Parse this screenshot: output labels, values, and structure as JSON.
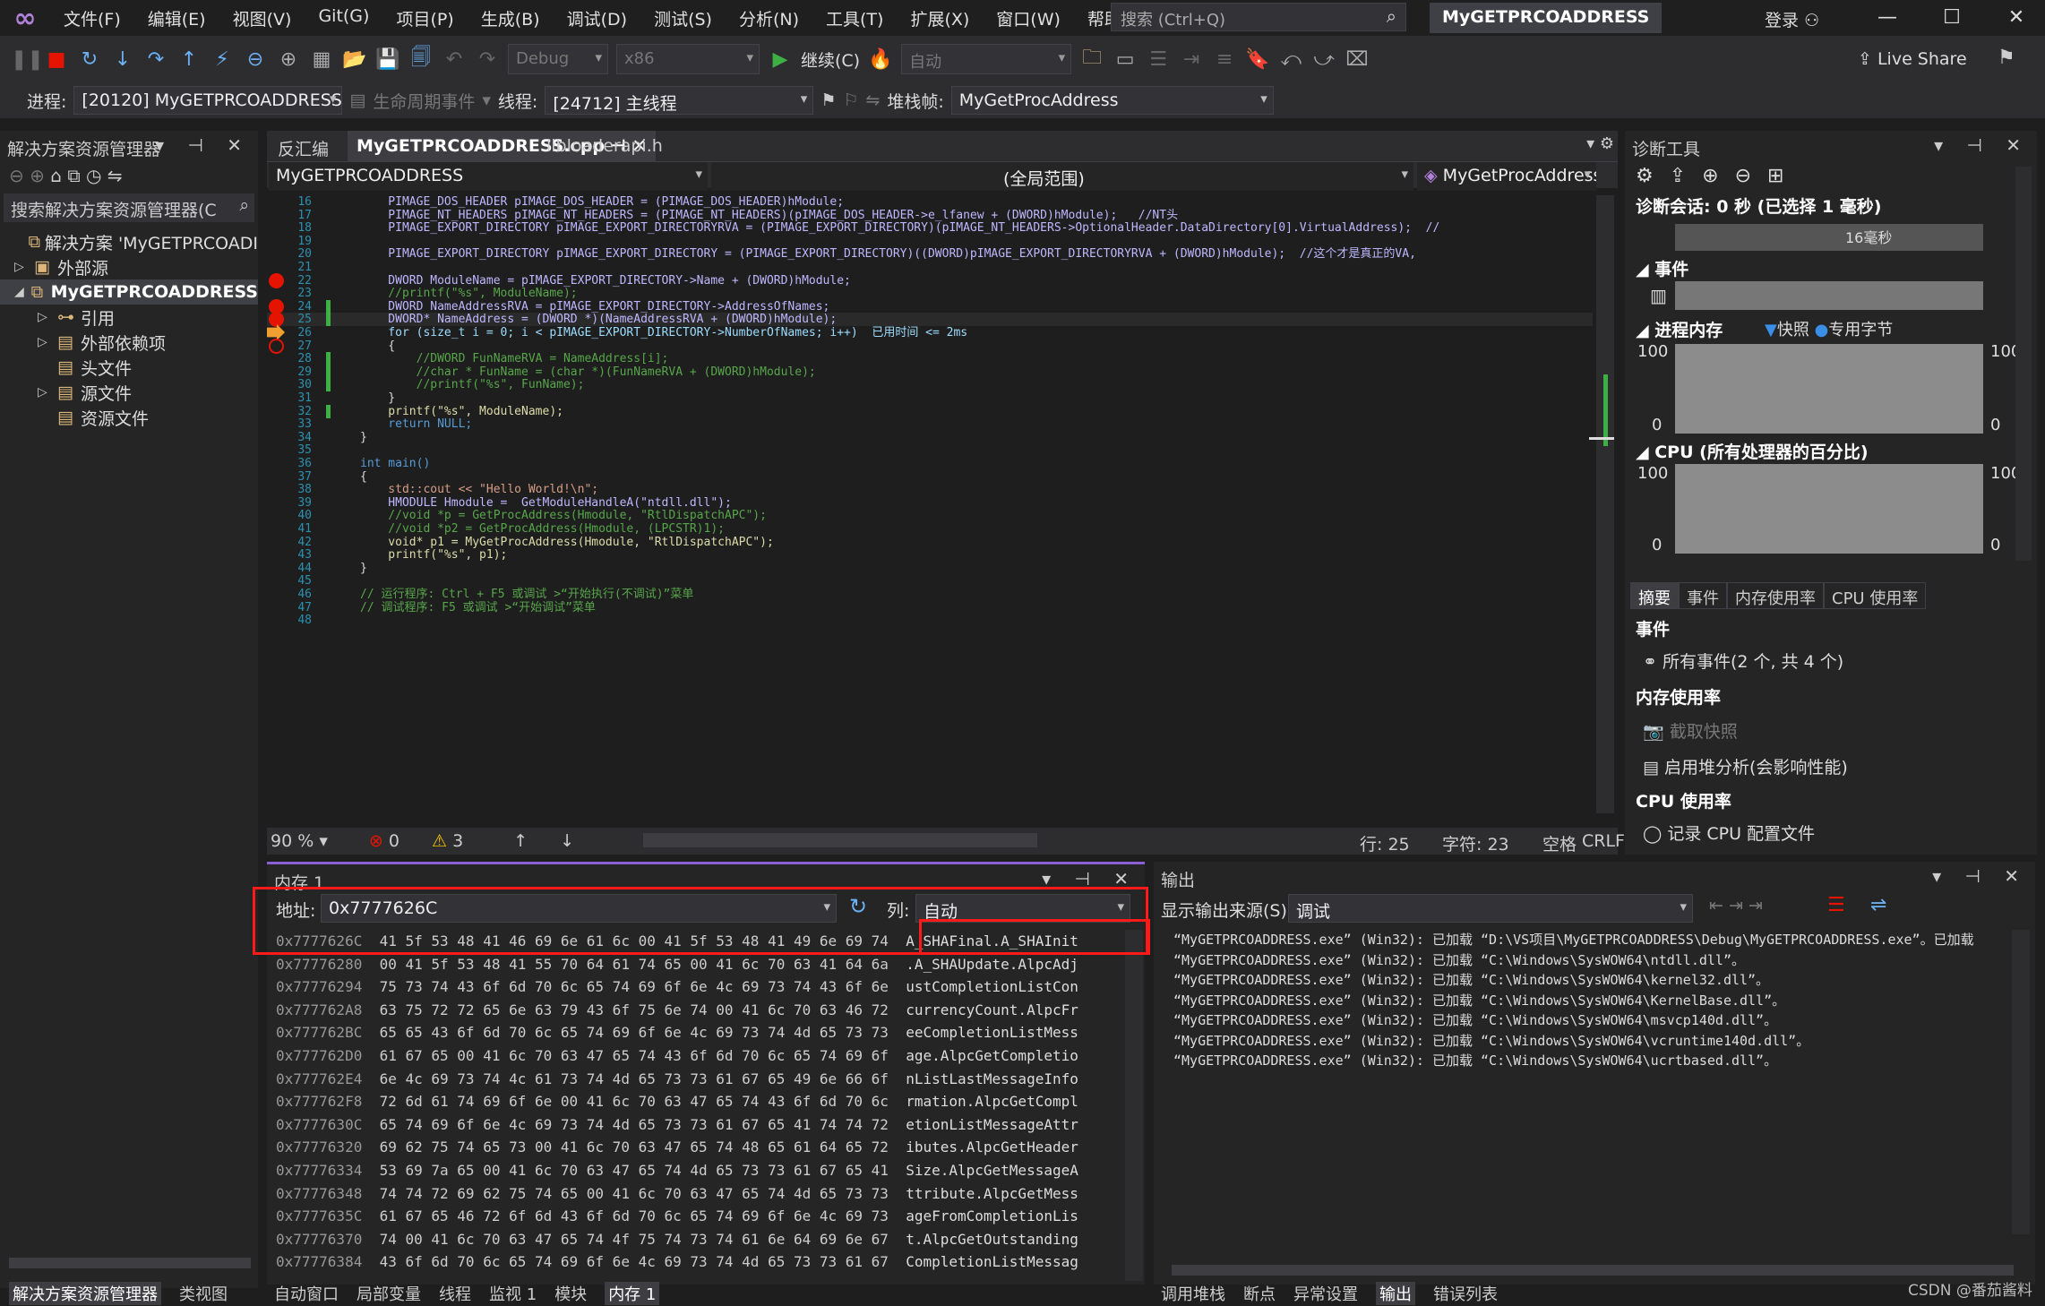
{
  "menu": [
    "文件(F)",
    "编辑(E)",
    "视图(V)",
    "Git(G)",
    "项目(P)",
    "生成(B)",
    "调试(D)",
    "测试(S)",
    "分析(N)",
    "工具(T)",
    "扩展(X)",
    "窗口(W)",
    "帮助(H)"
  ],
  "search_placeholder": "搜索 (Ctrl+Q)",
  "app_title": "MyGETPRCOADDRESS",
  "login": "登录",
  "toolbar": {
    "config": "Debug",
    "platform": "x86",
    "continue": "继续(C)",
    "auto": "自动",
    "live_share": "Live Share"
  },
  "debugbar": {
    "process_label": "进程:",
    "process": "[20120] MyGETPRCOADDRESS.",
    "lifecycle": "生命周期事件",
    "thread_label": "线程:",
    "thread": "[24712] 主线程",
    "frame_label": "堆栈帧:",
    "frame": "MyGetProcAddress"
  },
  "solution": {
    "title": "解决方案资源管理器",
    "search": "搜索解决方案资源管理器(C",
    "items": [
      {
        "label": "解决方案 'MyGETPRCOADI",
        "bold": false
      },
      {
        "label": "外部源",
        "bold": false
      },
      {
        "label": "MyGETPRCOADDRESS",
        "bold": true
      },
      {
        "label": "引用",
        "bold": false
      },
      {
        "label": "外部依赖项",
        "bold": false
      },
      {
        "label": "头文件",
        "bold": false
      },
      {
        "label": "源文件",
        "bold": false
      },
      {
        "label": "资源文件",
        "bold": false
      }
    ],
    "bottom_tabs": [
      "解决方案资源管理器",
      "类视图"
    ]
  },
  "editor": {
    "tabs": [
      "反汇编",
      "MyGETPRCOADDRESS.cpp",
      "libloaderapi.h"
    ],
    "nav_project": "MyGETPRCOADDRESS",
    "nav_scope": "(全局范围)",
    "nav_func": "MyGetProcAddress(HMODULE hModule, LPCSTR lp",
    "lines": [
      {
        "n": "16",
        "t": "    PIMAGE_DOS_HEADER pIMAGE_DOS_HEADER = (PIMAGE_DOS_HEADER)hModule;",
        "c": "c-mac"
      },
      {
        "n": "17",
        "t": "    PIMAGE_NT_HEADERS pIMAGE_NT_HEADERS = (PIMAGE_NT_HEADERS)(pIMAGE_DOS_HEADER->e_lfanew + (DWORD)hModule);   //NT头",
        "c": "c-mac"
      },
      {
        "n": "18",
        "t": "    PIMAGE_EXPORT_DIRECTORY pIMAGE_EXPORT_DIRECTORYRVA = (PIMAGE_EXPORT_DIRECTORY)(pIMAGE_NT_HEADERS->OptionalHeader.DataDirectory[0].VirtualAddress);  //",
        "c": "c-mac"
      },
      {
        "n": "19",
        "t": "",
        "c": ""
      },
      {
        "n": "20",
        "t": "    PIMAGE_EXPORT_DIRECTORY pIMAGE_EXPORT_DIRECTORY = (PIMAGE_EXPORT_DIRECTORY)((DWORD)pIMAGE_EXPORT_DIRECTORYRVA + (DWORD)hModule);  //这个才是真正的VA,",
        "c": "c-mac"
      },
      {
        "n": "21",
        "t": "",
        "c": ""
      },
      {
        "n": "22",
        "t": "    DWORD ModuleName = pIMAGE_EXPORT_DIRECTORY->Name + (DWORD)hModule;",
        "c": "c-mac"
      },
      {
        "n": "23",
        "t": "    //printf(\"%s\", ModuleName);",
        "c": "c-cm"
      },
      {
        "n": "24",
        "t": "    DWORD NameAddressRVA = pIMAGE_EXPORT_DIRECTORY->AddressOfNames;",
        "c": "c-mac"
      },
      {
        "n": "25",
        "t": "    DWORD* NameAddress = (DWORD *)(NameAddressRVA + (DWORD)hModule);",
        "c": "c-mac"
      },
      {
        "n": "26",
        "t": "    for (size_t i = 0; i < pIMAGE_EXPORT_DIRECTORY->NumberOfNames; i++)  已用时间 <= 2ms",
        "c": "c-var"
      },
      {
        "n": "27",
        "t": "    {",
        "c": ""
      },
      {
        "n": "28",
        "t": "        //DWORD FunNameRVA = NameAddress[i];",
        "c": "c-cm"
      },
      {
        "n": "29",
        "t": "        //char * FunName = (char *)(FunNameRVA + (DWORD)hModule);",
        "c": "c-cm"
      },
      {
        "n": "30",
        "t": "        //printf(\"%s\", FunName);",
        "c": "c-cm"
      },
      {
        "n": "31",
        "t": "    }",
        "c": ""
      },
      {
        "n": "32",
        "t": "    printf(\"%s\", ModuleName);",
        "c": "c-fn"
      },
      {
        "n": "33",
        "t": "    return NULL;",
        "c": "c-kw"
      },
      {
        "n": "34",
        "t": "}",
        "c": ""
      },
      {
        "n": "35",
        "t": "",
        "c": ""
      },
      {
        "n": "36",
        "t": "int main()",
        "c": "c-kw"
      },
      {
        "n": "37",
        "t": "{",
        "c": ""
      },
      {
        "n": "38",
        "t": "    std::cout << \"Hello World!\\n\";",
        "c": "c-st"
      },
      {
        "n": "39",
        "t": "    HMODULE Hmodule =  GetModuleHandleA(\"ntdll.dll\");",
        "c": "c-mac"
      },
      {
        "n": "40",
        "t": "    //void *p = GetProcAddress(Hmodule, \"RtlDispatchAPC\");",
        "c": "c-cm"
      },
      {
        "n": "41",
        "t": "    //void *p2 = GetProcAddress(Hmodule, (LPCSTR)1);",
        "c": "c-cm"
      },
      {
        "n": "42",
        "t": "    void* p1 = MyGetProcAddress(Hmodule, \"RtlDispatchAPC\");",
        "c": "c-fn"
      },
      {
        "n": "43",
        "t": "    printf(\"%s\", p1);",
        "c": "c-fn"
      },
      {
        "n": "44",
        "t": "}",
        "c": ""
      },
      {
        "n": "45",
        "t": "",
        "c": ""
      },
      {
        "n": "46",
        "t": "// 运行程序: Ctrl + F5 或调试 >“开始执行(不调试)”菜单",
        "c": "c-cm"
      },
      {
        "n": "47",
        "t": "// 调试程序: F5 或调试 >“开始调试”菜单",
        "c": "c-cm"
      },
      {
        "n": "48",
        "t": "",
        "c": ""
      }
    ],
    "status": {
      "zoom": "90 %",
      "errors": "0",
      "warnings": "3",
      "line": "行: 25",
      "char": "字符: 23",
      "space": "空格",
      "eol": "CRLF"
    }
  },
  "memory": {
    "title": "内存 1",
    "addr_label": "地址:",
    "addr": "0x7777626C",
    "col_label": "列:",
    "col": "自动",
    "rows": [
      {
        "a": "0x7777626C",
        "h": "41 5f 53 48 41 46 69 6e 61 6c 00 41 5f 53 48 41 49 6e 69 74",
        "s": "A_SHAFinal.A_SHAInit"
      },
      {
        "a": "0x77776280",
        "h": "00 41 5f 53 48 41 55 70 64 61 74 65 00 41 6c 70 63 41 64 6a",
        "s": ".A_SHAUpdate.AlpcAdj"
      },
      {
        "a": "0x77776294",
        "h": "75 73 74 43 6f 6d 70 6c 65 74 69 6f 6e 4c 69 73 74 43 6f 6e",
        "s": "ustCompletionListCon"
      },
      {
        "a": "0x777762A8",
        "h": "63 75 72 72 65 6e 63 79 43 6f 75 6e 74 00 41 6c 70 63 46 72",
        "s": "currencyCount.AlpcFr"
      },
      {
        "a": "0x777762BC",
        "h": "65 65 43 6f 6d 70 6c 65 74 69 6f 6e 4c 69 73 74 4d 65 73 73",
        "s": "eeCompletionListMess"
      },
      {
        "a": "0x777762D0",
        "h": "61 67 65 00 41 6c 70 63 47 65 74 43 6f 6d 70 6c 65 74 69 6f",
        "s": "age.AlpcGetCompletio"
      },
      {
        "a": "0x777762E4",
        "h": "6e 4c 69 73 74 4c 61 73 74 4d 65 73 73 61 67 65 49 6e 66 6f",
        "s": "nListLastMessageInfo"
      },
      {
        "a": "0x777762F8",
        "h": "72 6d 61 74 69 6f 6e 00 41 6c 70 63 47 65 74 43 6f 6d 70 6c",
        "s": "rmation.AlpcGetCompl"
      },
      {
        "a": "0x7777630C",
        "h": "65 74 69 6f 6e 4c 69 73 74 4d 65 73 73 61 67 65 41 74 74 72",
        "s": "etionListMessageAttr"
      },
      {
        "a": "0x77776320",
        "h": "69 62 75 74 65 73 00 41 6c 70 63 47 65 74 48 65 61 64 65 72",
        "s": "ibutes.AlpcGetHeader"
      },
      {
        "a": "0x77776334",
        "h": "53 69 7a 65 00 41 6c 70 63 47 65 74 4d 65 73 73 61 67 65 41",
        "s": "Size.AlpcGetMessageA"
      },
      {
        "a": "0x77776348",
        "h": "74 74 72 69 62 75 74 65 00 41 6c 70 63 47 65 74 4d 65 73 73",
        "s": "ttribute.AlpcGetMess"
      },
      {
        "a": "0x7777635C",
        "h": "61 67 65 46 72 6f 6d 43 6f 6d 70 6c 65 74 69 6f 6e 4c 69 73",
        "s": "ageFromCompletionLis"
      },
      {
        "a": "0x77776370",
        "h": "74 00 41 6c 70 63 47 65 74 4f 75 74 73 74 61 6e 64 69 6e 67",
        "s": "t.AlpcGetOutstanding"
      },
      {
        "a": "0x77776384",
        "h": "43 6f 6d 70 6c 65 74 69 6f 6e 4c 69 73 74 4d 65 73 73 61 67",
        "s": "CompletionListMessag"
      }
    ],
    "bottom_tabs": [
      "自动窗口",
      "局部变量",
      "线程",
      "监视 1",
      "模块",
      "内存 1"
    ]
  },
  "output": {
    "title": "输出",
    "source_label": "显示输出来源(S):",
    "source": "调试",
    "lines": [
      "“MyGETPRCOADDRESS.exe” (Win32): 已加载 “D:\\VS项目\\MyGETPRCOADDRESS\\Debug\\MyGETPRCOADDRESS.exe”。已加载",
      "“MyGETPRCOADDRESS.exe” (Win32): 已加载 “C:\\Windows\\SysWOW64\\ntdll.dll”。",
      "“MyGETPRCOADDRESS.exe” (Win32): 已加载 “C:\\Windows\\SysWOW64\\kernel32.dll”。",
      "“MyGETPRCOADDRESS.exe” (Win32): 已加载 “C:\\Windows\\SysWOW64\\KernelBase.dll”。",
      "“MyGETPRCOADDRESS.exe” (Win32): 已加载 “C:\\Windows\\SysWOW64\\msvcp140d.dll”。",
      "“MyGETPRCOADDRESS.exe” (Win32): 已加载 “C:\\Windows\\SysWOW64\\vcruntime140d.dll”。",
      "“MyGETPRCOADDRESS.exe” (Win32): 已加载 “C:\\Windows\\SysWOW64\\ucrtbased.dll”。"
    ],
    "bottom_tabs": [
      "调用堆栈",
      "断点",
      "异常设置",
      "输出",
      "错误列表"
    ]
  },
  "diag": {
    "title": "诊断工具",
    "session": "诊断会话: 0 秒 (已选择 1 毫秒)",
    "timeline_label": "16毫秒",
    "events": "事件",
    "process_mem": "进程内存",
    "snapshot": "快照",
    "private_bytes": "专用字节",
    "cpu": "CPU (所有处理器的百分比)",
    "axis_max": "100",
    "axis_min": "0",
    "tabs": [
      "摘要",
      "事件",
      "内存使用率",
      "CPU 使用率"
    ],
    "summary_events": "事件",
    "all_events": "所有事件(2 个, 共 4 个)",
    "mem_usage": "内存使用率",
    "take_snapshot": "截取快照",
    "heap_profile": "启用堆分析(会影响性能)",
    "cpu_usage": "CPU 使用率",
    "record_cpu": "记录 CPU 配置文件"
  },
  "watermark": "CSDN @番茄酱料"
}
